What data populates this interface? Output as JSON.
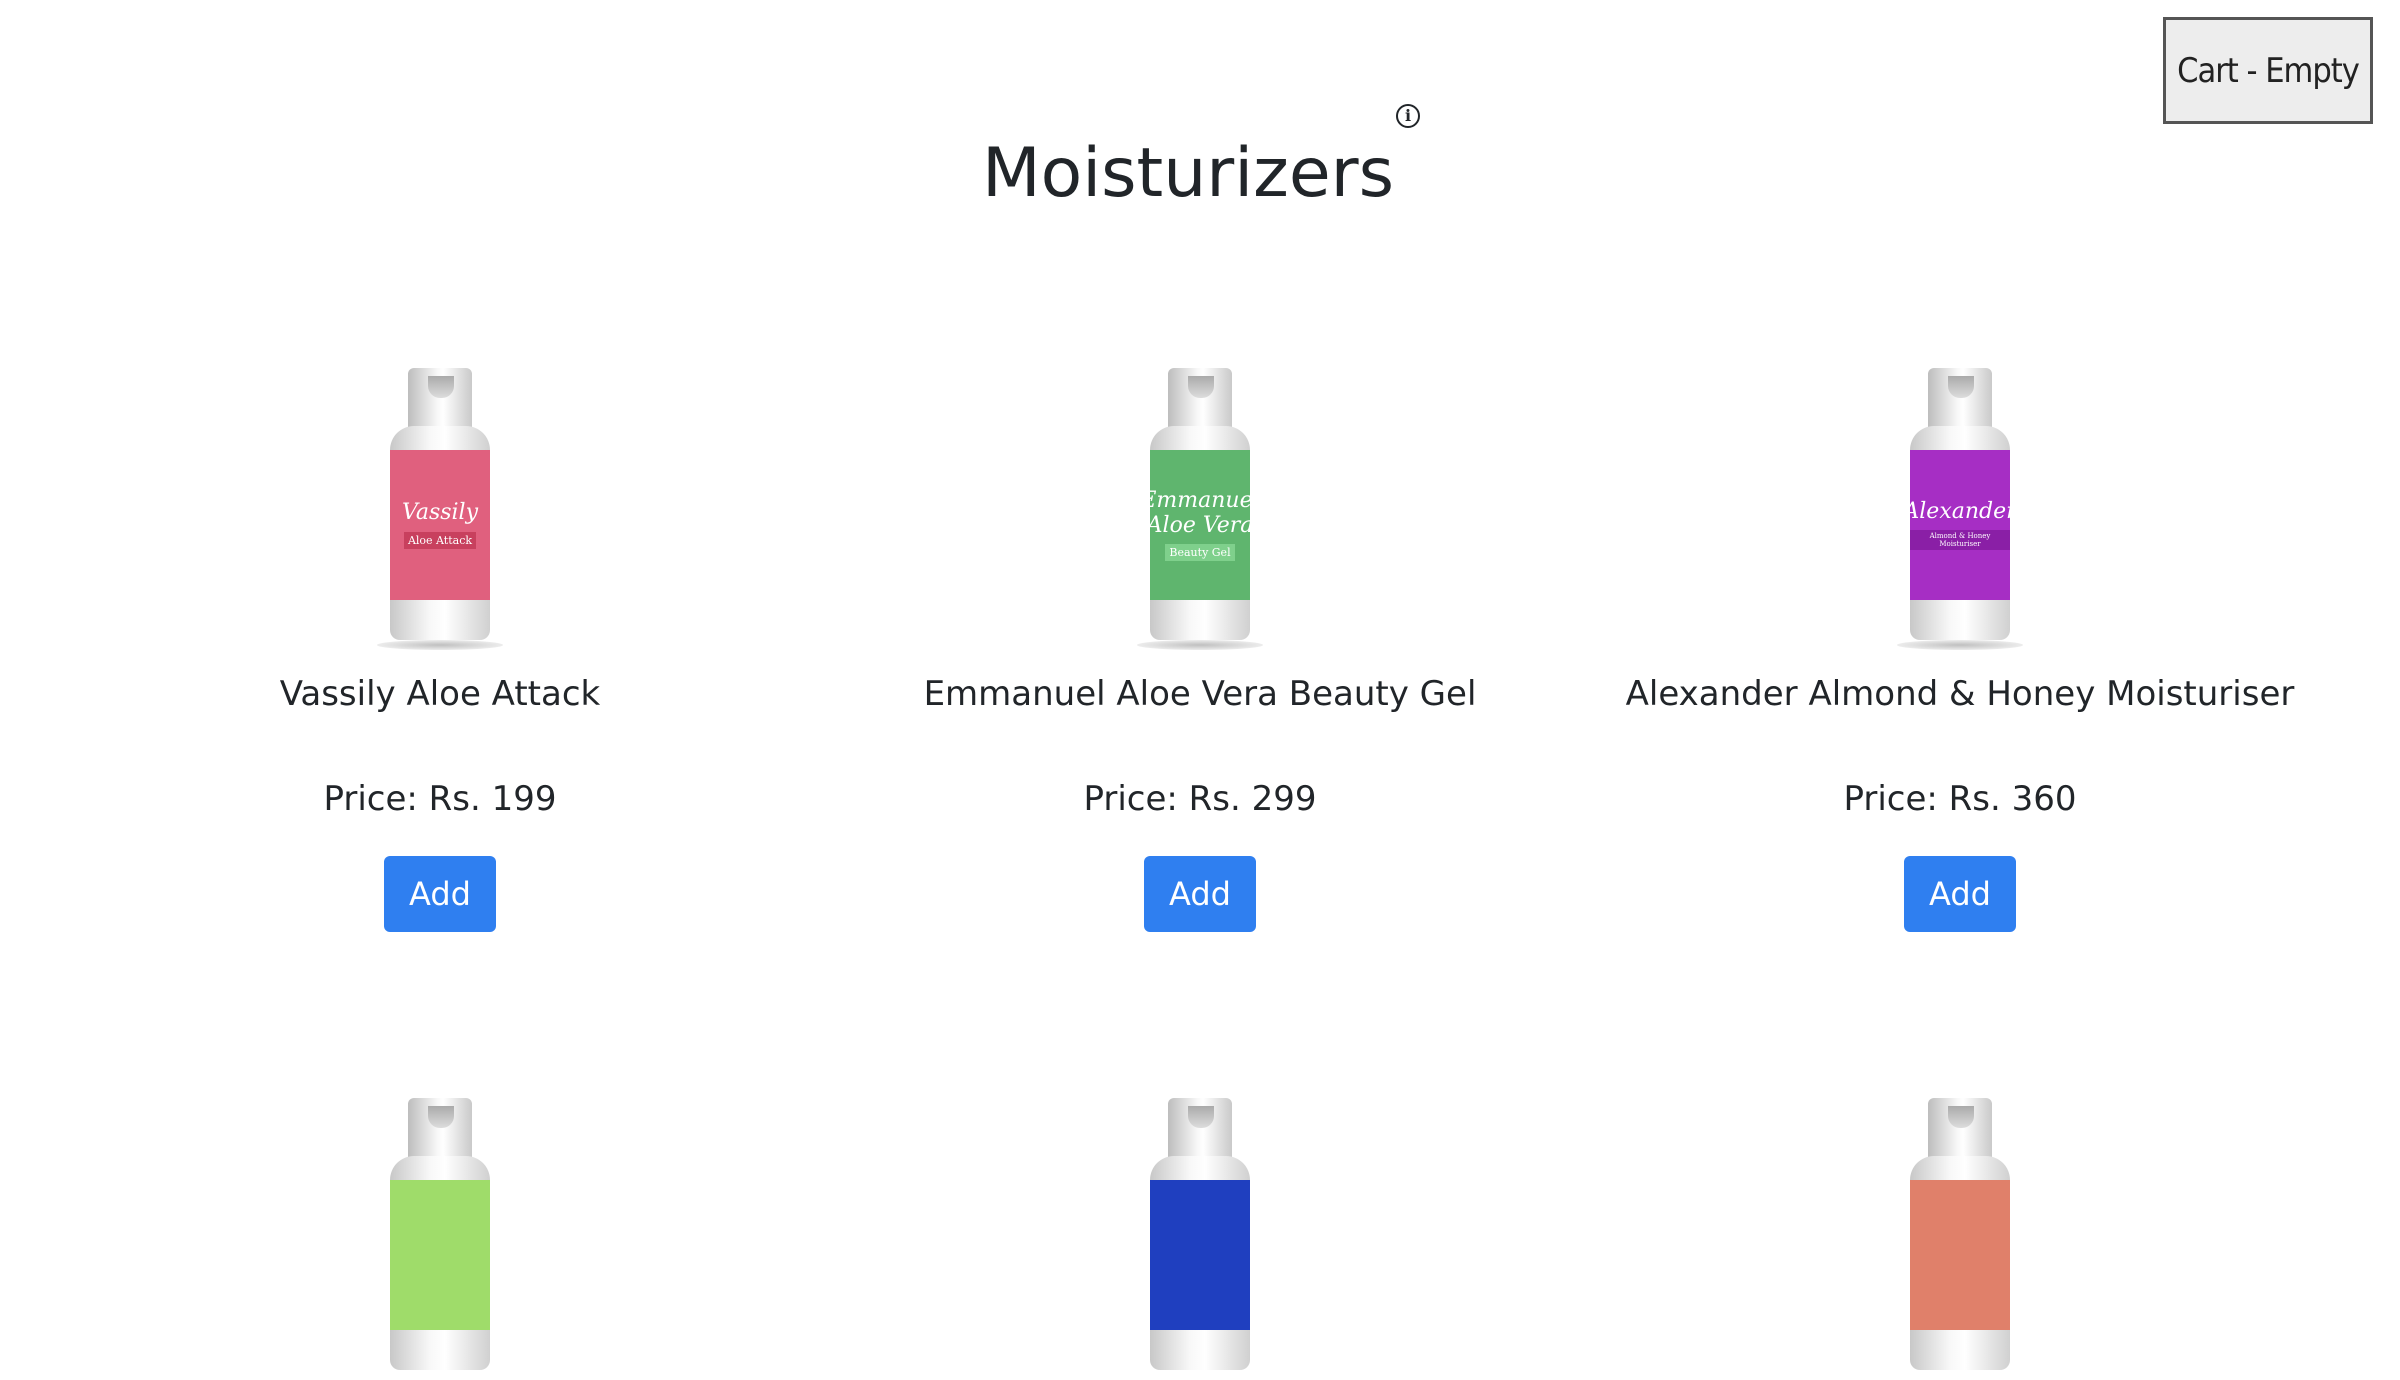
{
  "header": {
    "cart_label": "Cart - Empty",
    "page_title": "Moisturizers",
    "info_icon": "info-icon"
  },
  "colors": {
    "button_blue": "#2f7ff0",
    "text": "#212529"
  },
  "products": [
    {
      "name": "Vassily Aloe Attack",
      "price": "Price: Rs. 199",
      "add_label": "Add",
      "label_brand": "Vassily",
      "label_sub": "Aloe Attack",
      "label_color": "#e0607e",
      "sub_color": "#c8405e"
    },
    {
      "name": "Emmanuel Aloe Vera Beauty Gel",
      "price": "Price: Rs. 299",
      "add_label": "Add",
      "label_brand": "Emmanuel Aloe Vera",
      "label_sub": "Beauty Gel",
      "label_color": "#5fb56e",
      "sub_color": "#7fd08c"
    },
    {
      "name": "Alexander Almond & Honey Moisturiser",
      "price": "Price: Rs. 360",
      "add_label": "Add",
      "label_brand": "Alexander",
      "label_sub": "Almond & Honey Moisturiser",
      "label_color": "#a62ec4",
      "sub_color": "#8a1fa6"
    },
    {
      "label_color": "#9fdc6a"
    },
    {
      "label_color": "#1f3fbf"
    },
    {
      "label_color": "#e0806a"
    }
  ]
}
